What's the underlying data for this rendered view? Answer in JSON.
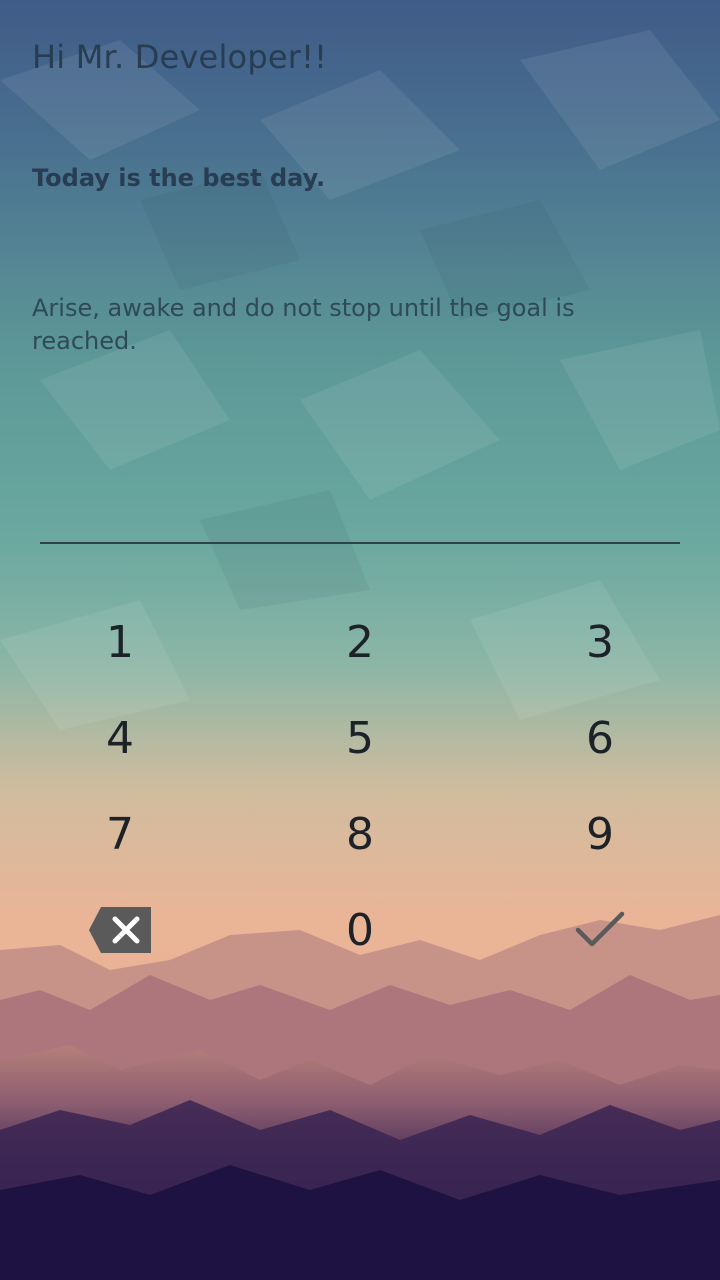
{
  "header": {
    "greeting": "Hi Mr. Developer!!",
    "subtitle": "Today is the best day.",
    "quote": "Arise, awake and do not stop until the goal is reached."
  },
  "pin": {
    "value": "",
    "placeholder": ""
  },
  "keypad": {
    "key_1": "1",
    "key_2": "2",
    "key_3": "3",
    "key_4": "4",
    "key_5": "5",
    "key_6": "6",
    "key_7": "7",
    "key_8": "8",
    "key_9": "9",
    "key_0": "0",
    "backspace_icon": "backspace-icon",
    "confirm_icon": "check-icon"
  },
  "colors": {
    "text_dark": "#283c52",
    "key_text": "#1c2228",
    "icon_gray": "#5a5a5a"
  }
}
